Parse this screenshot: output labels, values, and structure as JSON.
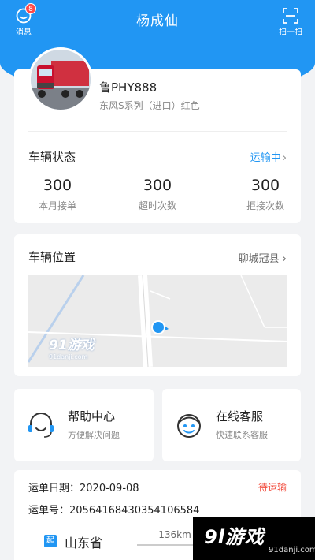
{
  "header": {
    "title": "杨成仙",
    "messages_label": "消息",
    "messages_badge": "8",
    "scan_label": "扫一扫"
  },
  "vehicle": {
    "plate": "鲁PHY888",
    "model": "东风S系列（进口）红色",
    "status_title": "车辆状态",
    "status_value": "运输中",
    "stats": [
      {
        "value": "300",
        "label": "本月接单"
      },
      {
        "value": "300",
        "label": "超时次数"
      },
      {
        "value": "300",
        "label": "拒接次数"
      }
    ]
  },
  "location": {
    "title": "车辆位置",
    "place": "聊城冠县",
    "map_watermark": "91游戏",
    "map_watermark_url": "91danji.com"
  },
  "services": {
    "help_title": "帮助中心",
    "help_sub": "方便解决问题",
    "service_title": "在线客服",
    "service_sub": "快速联系客服"
  },
  "order": {
    "date": "运单日期：2020-09-08",
    "status": "待运输",
    "number": "运单号：20564168430354106584",
    "start_tag": "起",
    "start_place": "山东省",
    "distance": "136km"
  },
  "watermark": {
    "brand": "9l游戏",
    "url": "91danji.com"
  },
  "colors": {
    "primary": "#2196f3",
    "alert": "#f24c3d"
  }
}
